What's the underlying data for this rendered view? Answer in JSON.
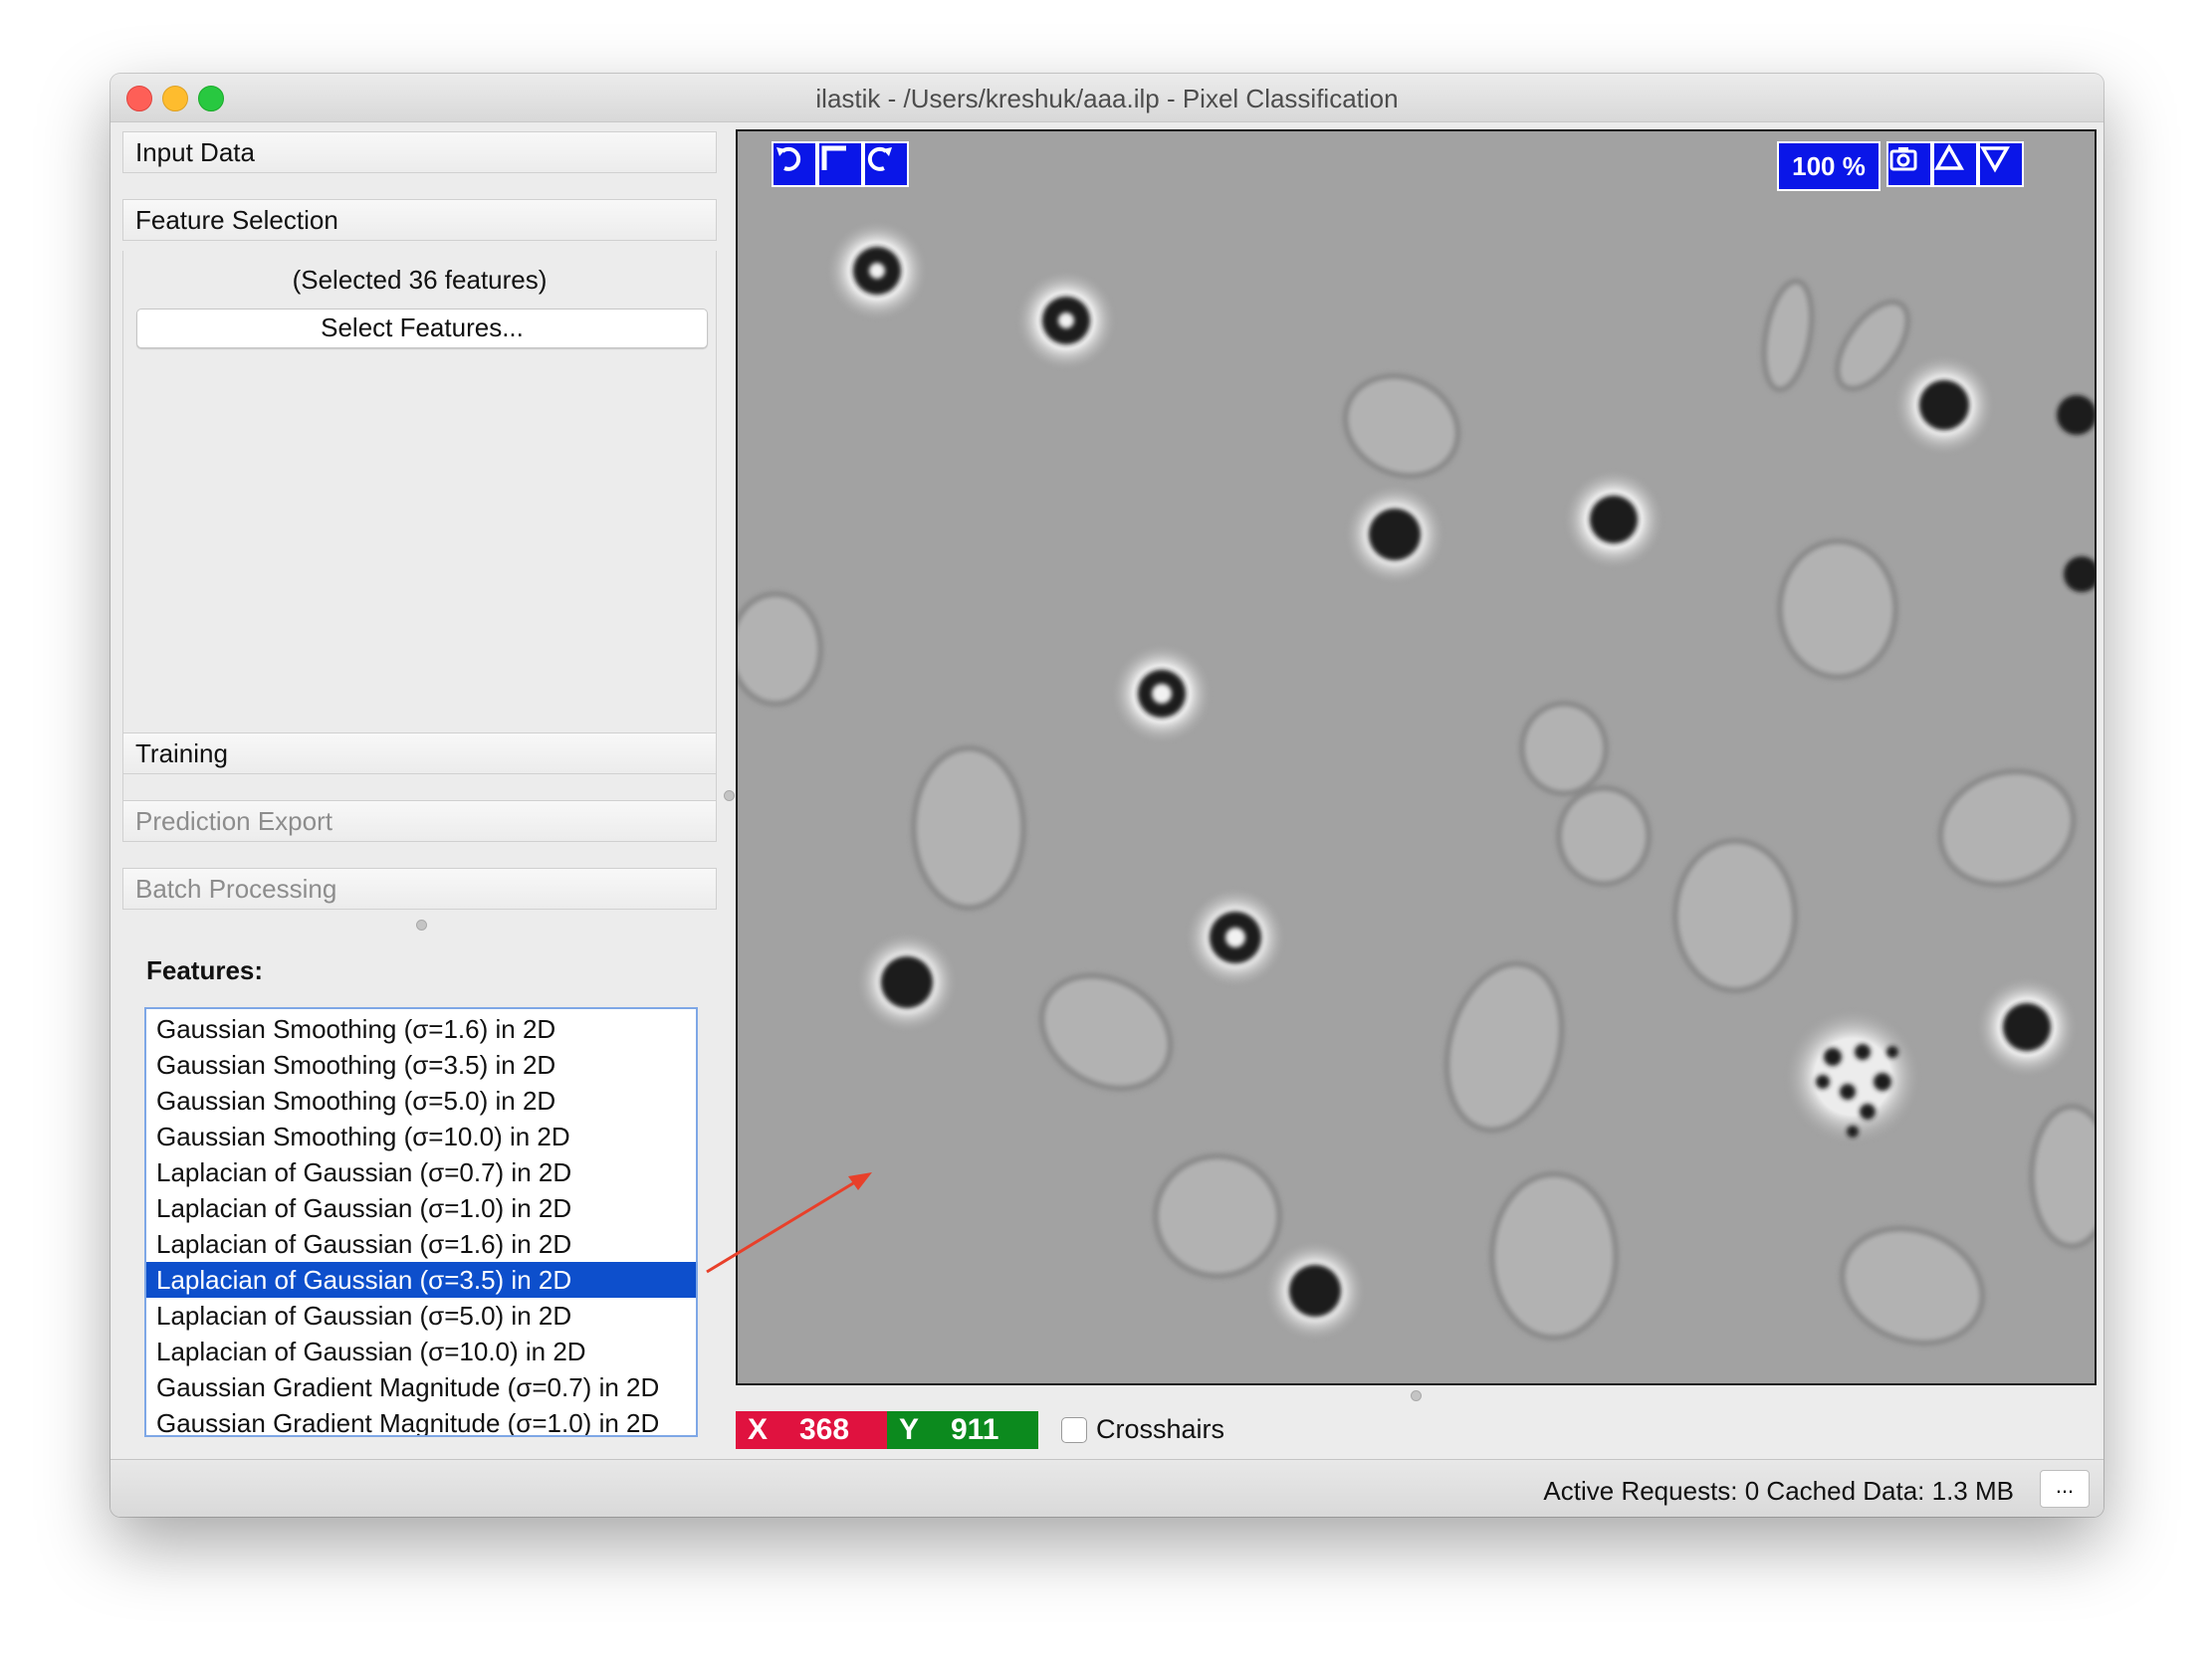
{
  "window": {
    "title": "ilastik - /Users/kreshuk/aaa.ilp - Pixel Classification"
  },
  "drawer": {
    "input_data": "Input Data",
    "feature_selection": "Feature Selection",
    "selected_count": "(Selected 36 features)",
    "select_features_button": "Select Features...",
    "training": "Training",
    "prediction_export": "Prediction Export",
    "batch_processing": "Batch Processing"
  },
  "features": {
    "label": "Features:",
    "items": [
      "Gaussian Smoothing (σ=1.6) in 2D",
      "Gaussian Smoothing (σ=3.5) in 2D",
      "Gaussian Smoothing (σ=5.0) in 2D",
      "Gaussian Smoothing (σ=10.0) in 2D",
      "Laplacian of Gaussian (σ=0.7) in 2D",
      "Laplacian of Gaussian (σ=1.0) in 2D",
      "Laplacian of Gaussian (σ=1.6) in 2D",
      "Laplacian of Gaussian (σ=3.5) in 2D",
      "Laplacian of Gaussian (σ=5.0) in 2D",
      "Laplacian of Gaussian (σ=10.0) in 2D",
      "Gaussian Gradient Magnitude (σ=0.7) in 2D",
      "Gaussian Gradient Magnitude (σ=1.0) in 2D"
    ],
    "selected_index": 7
  },
  "viewer": {
    "zoom": "100 %",
    "tool_icons": [
      "undo-icon",
      "fit-icon",
      "redo-icon",
      "camera-icon",
      "triangle-up-icon",
      "triangle-down-icon"
    ]
  },
  "coords": {
    "x_label": "X",
    "x_value": "368",
    "y_label": "Y",
    "y_value": "911",
    "x_color": "#e0123f",
    "y_color": "#0c8a1e",
    "crosshairs_label": "Crosshairs"
  },
  "status": {
    "text": "Active Requests: 0  Cached Data: 1.3 MB",
    "more_button": "..."
  },
  "colors": {
    "accent": "#0d4fcc",
    "viewer_buttons": "#0a16e8",
    "annotation_arrow": "#e8402a"
  }
}
